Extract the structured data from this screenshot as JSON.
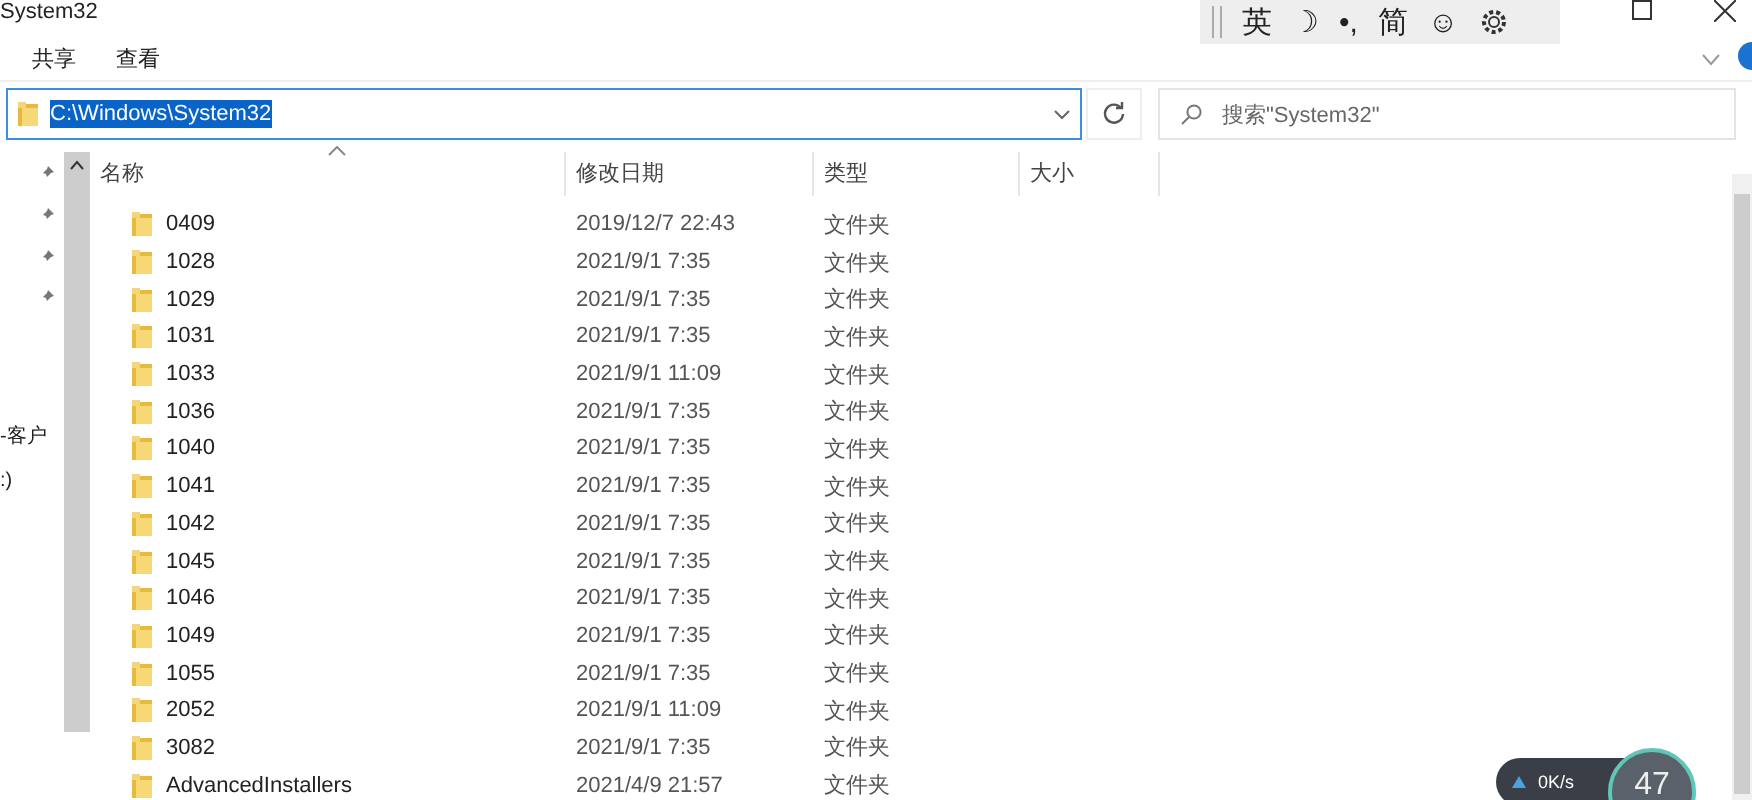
{
  "window": {
    "title": "System32"
  },
  "ime_toolbar": [
    "英",
    "☽",
    "•,",
    "简",
    "☺"
  ],
  "ribbon_tabs": [
    {
      "label": "共享"
    },
    {
      "label": "查看"
    }
  ],
  "address": {
    "value": "C:\\Windows\\System32",
    "selected": true
  },
  "search": {
    "placeholder": "搜索\"System32\""
  },
  "sidebar": {
    "items": [
      {
        "kind": "pinned"
      },
      {
        "kind": "pinned"
      },
      {
        "kind": "pinned"
      },
      {
        "kind": "pinned"
      },
      {
        "kind": "drive",
        "label": "-客户"
      },
      {
        "kind": "drive",
        "label": ":)"
      }
    ]
  },
  "table": {
    "columns": [
      "名称",
      "修改日期",
      "类型",
      "大小"
    ],
    "rows": [
      {
        "name": "0409",
        "date": "2019/12/7 22:43",
        "type": "文件夹"
      },
      {
        "name": "1028",
        "date": "2021/9/1 7:35",
        "type": "文件夹"
      },
      {
        "name": "1029",
        "date": "2021/9/1 7:35",
        "type": "文件夹"
      },
      {
        "name": "1031",
        "date": "2021/9/1 7:35",
        "type": "文件夹"
      },
      {
        "name": "1033",
        "date": "2021/9/1 11:09",
        "type": "文件夹"
      },
      {
        "name": "1036",
        "date": "2021/9/1 7:35",
        "type": "文件夹"
      },
      {
        "name": "1040",
        "date": "2021/9/1 7:35",
        "type": "文件夹"
      },
      {
        "name": "1041",
        "date": "2021/9/1 7:35",
        "type": "文件夹"
      },
      {
        "name": "1042",
        "date": "2021/9/1 7:35",
        "type": "文件夹"
      },
      {
        "name": "1045",
        "date": "2021/9/1 7:35",
        "type": "文件夹"
      },
      {
        "name": "1046",
        "date": "2021/9/1 7:35",
        "type": "文件夹"
      },
      {
        "name": "1049",
        "date": "2021/9/1 7:35",
        "type": "文件夹"
      },
      {
        "name": "1055",
        "date": "2021/9/1 7:35",
        "type": "文件夹"
      },
      {
        "name": "2052",
        "date": "2021/9/1 11:09",
        "type": "文件夹"
      },
      {
        "name": "3082",
        "date": "2021/9/1 7:35",
        "type": "文件夹"
      },
      {
        "name": "AdvancedInstallers",
        "date": "2021/4/9 21:57",
        "type": "文件夹"
      }
    ]
  },
  "network_widget": {
    "speed": "0K/s",
    "percent": "47"
  }
}
